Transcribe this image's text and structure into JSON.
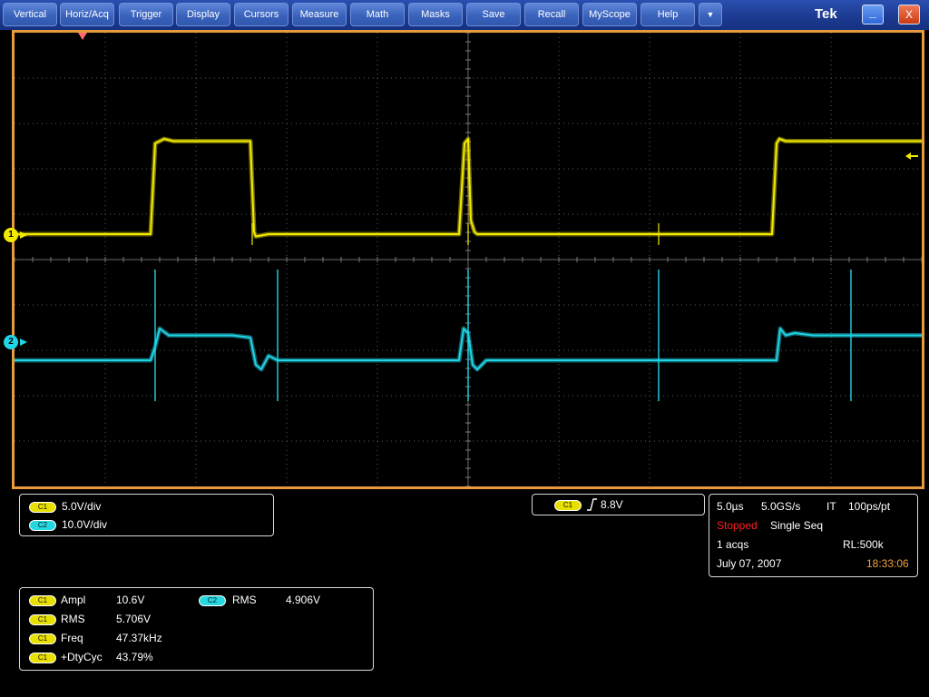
{
  "menu": {
    "items": [
      {
        "label": "Vertical",
        "name": "menu-vertical"
      },
      {
        "label": "Horiz/Acq",
        "name": "menu-horiz-acq"
      },
      {
        "label": "Trigger",
        "name": "menu-trigger"
      },
      {
        "label": "Display",
        "name": "menu-display"
      },
      {
        "label": "Cursors",
        "name": "menu-cursors"
      },
      {
        "label": "Measure",
        "name": "menu-measure"
      },
      {
        "label": "Math",
        "name": "menu-math"
      },
      {
        "label": "Masks",
        "name": "menu-masks"
      },
      {
        "label": "Save",
        "name": "menu-save"
      },
      {
        "label": "Recall",
        "name": "menu-recall"
      },
      {
        "label": "MyScope",
        "name": "menu-myscope"
      },
      {
        "label": "Help",
        "name": "menu-help"
      }
    ],
    "more_icon": "▼",
    "brand": "Tek",
    "minimize_icon": "_",
    "close_icon": "X"
  },
  "colors": {
    "ch1": "#f3ea00",
    "ch2": "#1fd5e6",
    "frame": "#e89b3d",
    "stopped": "#ff2020",
    "time": "#f0a040"
  },
  "channels": [
    {
      "marker": "1",
      "badge": "C1",
      "scale": "5.0V/div"
    },
    {
      "marker": "2",
      "badge": "C2",
      "scale": "10.0V/div"
    }
  ],
  "trigger": {
    "badge": "C1",
    "slope_icon": "rising-edge-icon",
    "level": "8.8V"
  },
  "acquisition": {
    "timebase": "5.0µs",
    "sample_rate": "5.0GS/s",
    "mode": "IT",
    "resolution": "100ps/pt",
    "state": "Stopped",
    "sequence": "Single Seq",
    "acqs": "1 acqs",
    "record_length": "RL:500k",
    "date": "July 07, 2007",
    "time": "18:33:06"
  },
  "measurements": [
    {
      "badge": "C1",
      "label": "Ampl",
      "value": "10.6V"
    },
    {
      "badge": "C1",
      "label": "RMS",
      "value": "5.706V"
    },
    {
      "badge": "C1",
      "label": "Freq",
      "value": "47.37kHz"
    },
    {
      "badge": "C1",
      "label": "+DtyCyc",
      "value": "43.79%"
    },
    {
      "badge": "C2",
      "label": "RMS",
      "value": "4.906V"
    }
  ],
  "chart_data": {
    "type": "line",
    "x_divisions": 10,
    "y_divisions": 10,
    "series": [
      {
        "badge": "C1",
        "volts_per_div": 5.0,
        "x_div": [
          0,
          1.5,
          1.55,
          1.65,
          1.75,
          2.0,
          2.4,
          2.6,
          2.64,
          2.66,
          2.8,
          3.5,
          4.2,
          4.9,
          4.96,
          5.0,
          5.03,
          5.07,
          5.1,
          6.0,
          7.0,
          8.0,
          8.35,
          8.4,
          8.43,
          8.5,
          8.7,
          8.8,
          8.9,
          9.2,
          10
        ],
        "y_div": [
          0,
          0,
          2.0,
          2.1,
          2.05,
          2.05,
          2.05,
          2.05,
          0.05,
          -0.05,
          0,
          0,
          0,
          0,
          2.0,
          2.1,
          0.3,
          0.05,
          0,
          0,
          0,
          0,
          0,
          2.0,
          2.1,
          2.05,
          2.05,
          2.05,
          2.05,
          2.05,
          2.05
        ]
      },
      {
        "badge": "C2",
        "volts_per_div": 10.0,
        "x_div": [
          0,
          1.5,
          1.55,
          1.6,
          1.7,
          1.8,
          2.0,
          2.4,
          2.6,
          2.66,
          2.72,
          2.8,
          2.9,
          3.0,
          3.5,
          4.2,
          4.9,
          4.95,
          5.0,
          5.05,
          5.1,
          5.2,
          5.3,
          6.0,
          7.0,
          8.0,
          8.4,
          8.44,
          8.5,
          8.6,
          8.8,
          9.2,
          10
        ],
        "y_div": [
          0,
          0,
          0.3,
          0.7,
          0.55,
          0.55,
          0.55,
          0.55,
          0.5,
          -0.1,
          -0.2,
          0.1,
          0,
          0,
          0,
          0,
          0,
          0.7,
          0.6,
          -0.1,
          -0.2,
          0,
          0,
          0,
          0,
          0,
          0,
          0.7,
          0.55,
          0.6,
          0.55,
          0.55,
          0.55
        ]
      }
    ]
  }
}
